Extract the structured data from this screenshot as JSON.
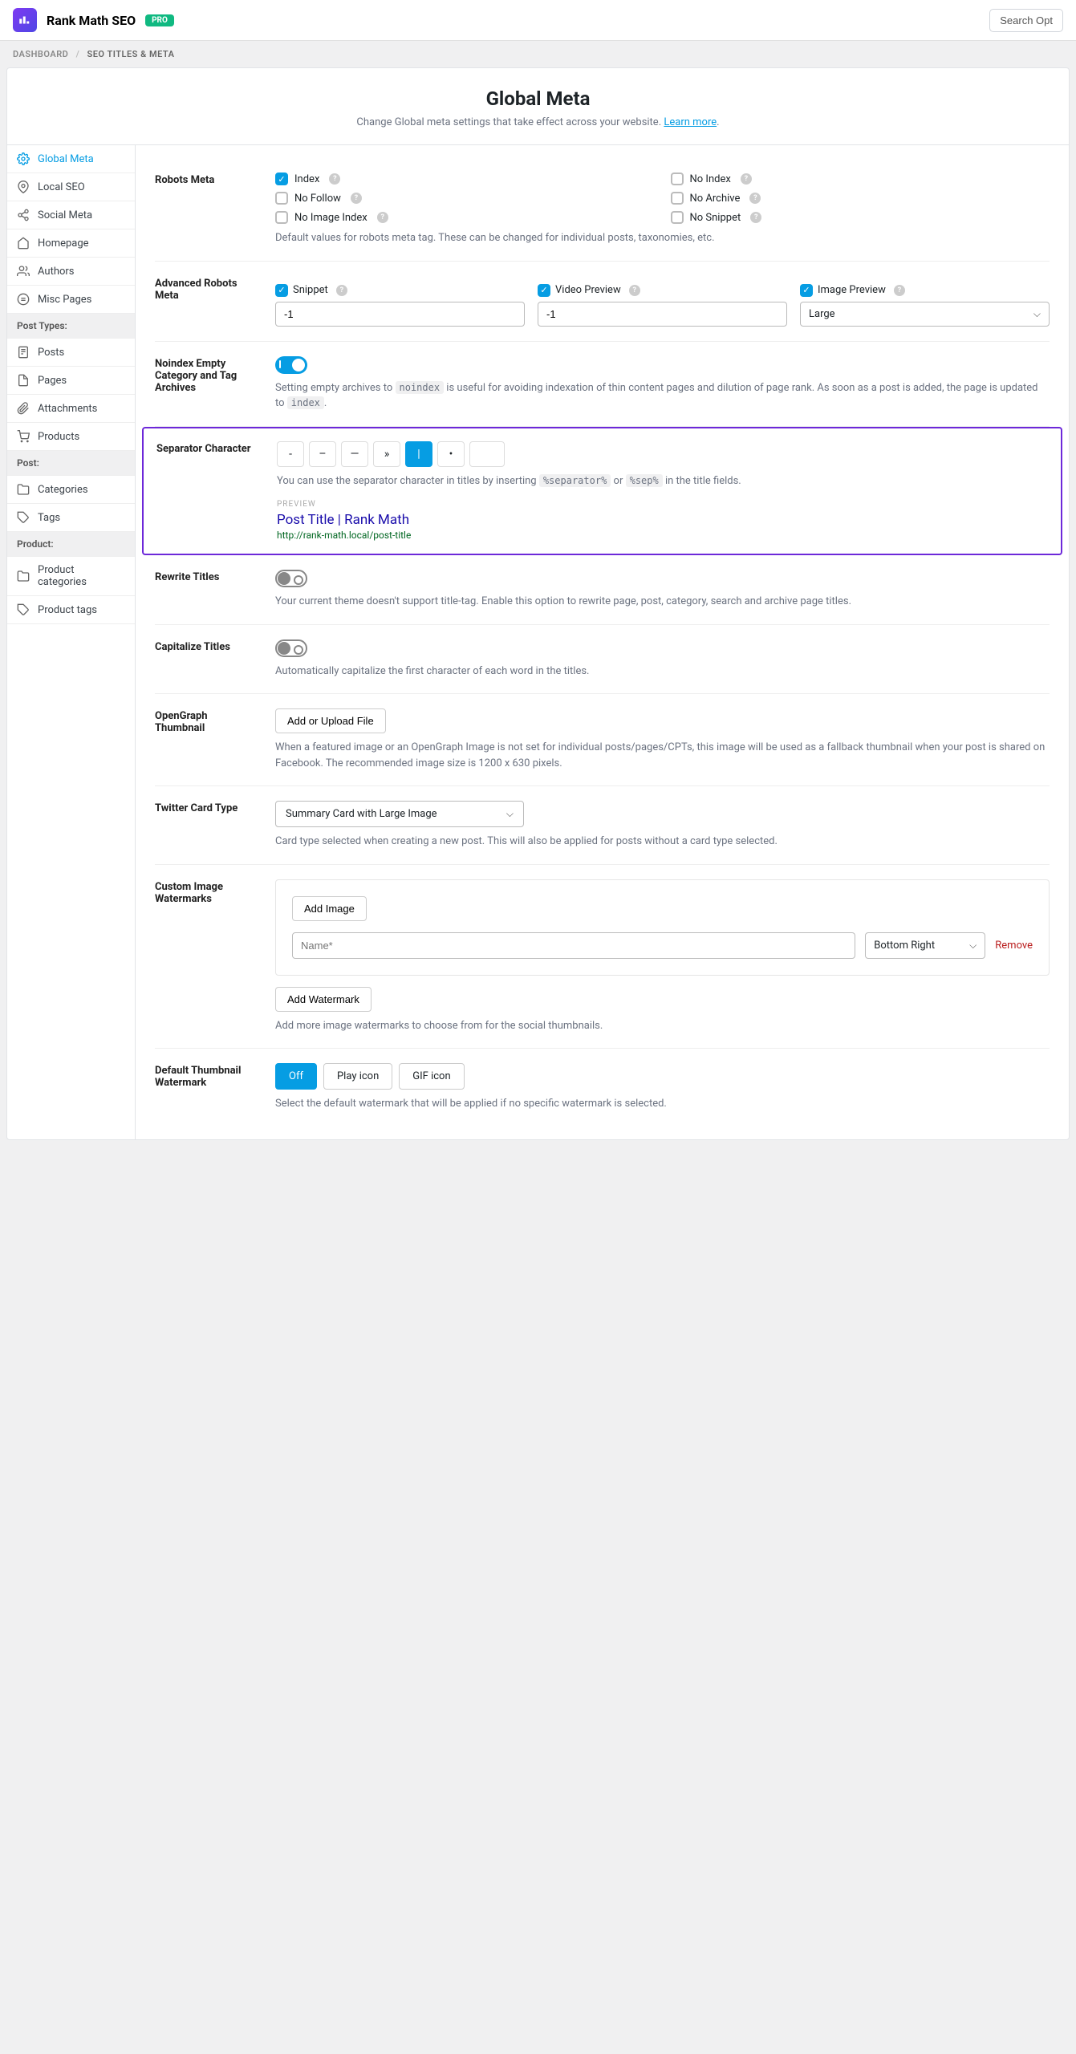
{
  "header": {
    "app_title": "Rank Math SEO",
    "pro_badge": "PRO",
    "search_label": "Search Opt"
  },
  "breadcrumb": {
    "item1": "DASHBOARD",
    "sep": "/",
    "item2": "SEO TITLES & META"
  },
  "page": {
    "title": "Global Meta",
    "subtitle": "Change Global meta settings that take effect across your website. ",
    "learn_more": "Learn more"
  },
  "sidebar": {
    "items": [
      {
        "label": "Global Meta",
        "active": true
      },
      {
        "label": "Local SEO"
      },
      {
        "label": "Social Meta"
      },
      {
        "label": "Homepage"
      },
      {
        "label": "Authors"
      },
      {
        "label": "Misc Pages"
      }
    ],
    "heading_post_types": "Post Types:",
    "post_types": [
      {
        "label": "Posts"
      },
      {
        "label": "Pages"
      },
      {
        "label": "Attachments"
      },
      {
        "label": "Products"
      }
    ],
    "heading_post": "Post:",
    "post_tax": [
      {
        "label": "Categories"
      },
      {
        "label": "Tags"
      }
    ],
    "heading_product": "Product:",
    "product_tax": [
      {
        "label": "Product categories"
      },
      {
        "label": "Product tags"
      }
    ]
  },
  "robots": {
    "label": "Robots Meta",
    "opts": {
      "index": "Index",
      "no_index": "No Index",
      "no_follow": "No Follow",
      "no_archive": "No Archive",
      "no_image_index": "No Image Index",
      "no_snippet": "No Snippet"
    },
    "desc": "Default values for robots meta tag. These can be changed for individual posts, taxonomies, etc."
  },
  "adv_robots": {
    "label": "Advanced Robots Meta",
    "snippet": "Snippet",
    "snippet_val": "-1",
    "video": "Video Preview",
    "video_val": "-1",
    "image": "Image Preview",
    "image_val": "Large"
  },
  "noindex": {
    "label": "Noindex Empty Category and Tag Archives",
    "desc1": "Setting empty archives to ",
    "code1": "noindex",
    "desc2": " is useful for avoiding indexation of thin content pages and dilution of page rank. As soon as a post is added, the page is updated to ",
    "code2": "index",
    "desc3": "."
  },
  "separator": {
    "label": "Separator Character",
    "opts": [
      "-",
      "–",
      "—",
      "»",
      "|",
      "•",
      ""
    ],
    "desc1": "You can use the separator character in titles by inserting ",
    "code1": "%separator%",
    "desc2": " or ",
    "code2": "%sep%",
    "desc3": " in the title fields.",
    "preview_label": "PREVIEW",
    "preview_title": "Post Title | Rank Math",
    "preview_url": "http://rank-math.local/post-title"
  },
  "rewrite": {
    "label": "Rewrite Titles",
    "desc": "Your current theme doesn't support title-tag. Enable this option to rewrite page, post, category, search and archive page titles."
  },
  "capitalize": {
    "label": "Capitalize Titles",
    "desc": "Automatically capitalize the first character of each word in the titles."
  },
  "og": {
    "label": "OpenGraph Thumbnail",
    "btn": "Add or Upload File",
    "desc": "When a featured image or an OpenGraph Image is not set for individual posts/pages/CPTs, this image will be used as a fallback thumbnail when your post is shared on Facebook. The recommended image size is 1200 x 630 pixels."
  },
  "twitter": {
    "label": "Twitter Card Type",
    "value": "Summary Card with Large Image",
    "desc": "Card type selected when creating a new post. This will also be applied for posts without a card type selected."
  },
  "watermarks": {
    "label": "Custom Image Watermarks",
    "add_image": "Add Image",
    "name_ph": "Name*",
    "position": "Bottom Right",
    "remove": "Remove",
    "add_btn": "Add Watermark",
    "desc": "Add more image watermarks to choose from for the social thumbnails."
  },
  "default_wm": {
    "label": "Default Thumbnail Watermark",
    "opts": [
      "Off",
      "Play icon",
      "GIF icon"
    ],
    "desc": "Select the default watermark that will be applied if no specific watermark is selected."
  }
}
